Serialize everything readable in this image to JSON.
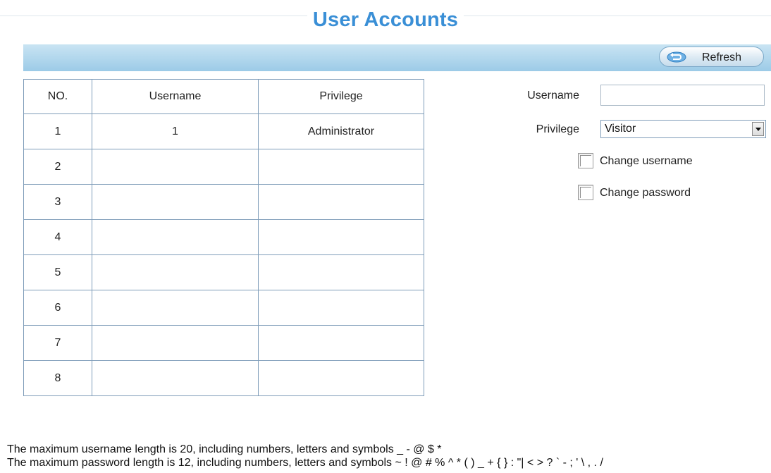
{
  "page": {
    "title": "User Accounts"
  },
  "toolbar": {
    "refresh_label": "Refresh"
  },
  "table": {
    "headers": [
      "NO.",
      "Username",
      "Privilege"
    ],
    "rows": [
      {
        "no": "1",
        "username": "1",
        "privilege": "Administrator"
      },
      {
        "no": "2",
        "username": "",
        "privilege": ""
      },
      {
        "no": "3",
        "username": "",
        "privilege": ""
      },
      {
        "no": "4",
        "username": "",
        "privilege": ""
      },
      {
        "no": "5",
        "username": "",
        "privilege": ""
      },
      {
        "no": "6",
        "username": "",
        "privilege": ""
      },
      {
        "no": "7",
        "username": "",
        "privilege": ""
      },
      {
        "no": "8",
        "username": "",
        "privilege": ""
      }
    ]
  },
  "form": {
    "username_label": "Username",
    "username_value": "",
    "privilege_label": "Privilege",
    "privilege_value": "Visitor",
    "change_username_label": "Change username",
    "change_username_checked": false,
    "change_password_label": "Change password",
    "change_password_checked": false
  },
  "notes": {
    "username_rule": "The maximum username length is 20, including numbers, letters and symbols _ - @ $ *",
    "password_rule": "The maximum password length is 12, including numbers, letters and symbols ~ ! @ # % ^ * ( ) _ + { } : \"| < > ? ` - ; ' \\ , . /"
  },
  "icons": {
    "refresh": "refresh-icon",
    "dropdown": "chevron-down-icon"
  },
  "colors": {
    "title": "#3a8fd6",
    "toolbar_top": "#c9e4f3",
    "toolbar_bottom": "#9ccbe7",
    "table_border": "#7f9db9"
  }
}
